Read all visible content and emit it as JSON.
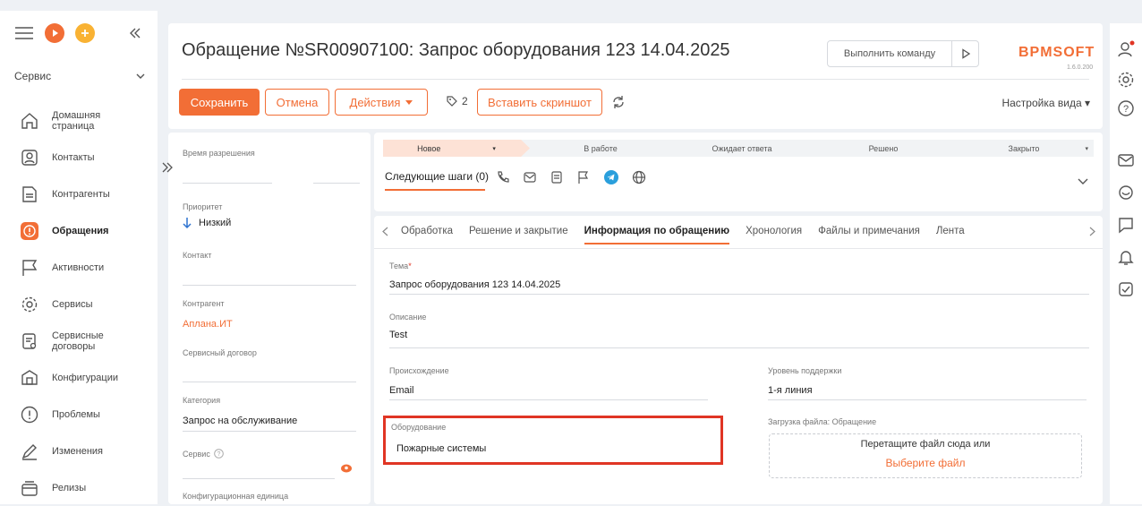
{
  "nav": {
    "section": "Сервис",
    "items": [
      {
        "label": "Домашняя страница",
        "icon": "home-icon"
      },
      {
        "label": "Контакты",
        "icon": "contact-icon"
      },
      {
        "label": "Контрагенты",
        "icon": "account-icon"
      },
      {
        "label": "Обращения",
        "icon": "case-icon",
        "active": true
      },
      {
        "label": "Активности",
        "icon": "flag-icon"
      },
      {
        "label": "Сервисы",
        "icon": "gear-icon"
      },
      {
        "label": "Сервисные договоры",
        "icon": "contract-icon"
      },
      {
        "label": "Конфигурации",
        "icon": "config-icon"
      },
      {
        "label": "Проблемы",
        "icon": "problem-icon"
      },
      {
        "label": "Изменения",
        "icon": "pencil-icon"
      },
      {
        "label": "Релизы",
        "icon": "release-icon"
      }
    ]
  },
  "header": {
    "title": "Обращение №SR00907100: Запрос оборудования 123 14.04.2025",
    "command_placeholder": "Выполнить команду",
    "logo": "BPMSOFT",
    "version": "1.6.0.200",
    "save": "Сохранить",
    "cancel": "Отмена",
    "actions": "Действия",
    "counter": "2",
    "screenshot": "Вставить скриншот",
    "view_settings": "Настройка вида"
  },
  "left": {
    "resolution_time_label": "Время разрешения",
    "priority_label": "Приоритет",
    "priority_value": "Низкий",
    "contact_label": "Контакт",
    "account_label": "Контрагент",
    "account_value": "Аплана.ИТ",
    "contract_label": "Сервисный договор",
    "category_label": "Категория",
    "category_value": "Запрос на обслуживание",
    "service_label": "Сервис",
    "config_item_label": "Конфигурационная единица"
  },
  "stages": [
    "Новое",
    "В работе",
    "Ожидает ответа",
    "Решено",
    "Закрыто"
  ],
  "next_steps": "Следующие шаги (0)",
  "tabs": [
    "Обработка",
    "Решение и закрытие",
    "Информация по обращению",
    "Хронология",
    "Файлы и примечания",
    "Лента"
  ],
  "form": {
    "subject_label": "Тема",
    "subject_value": "Запрос оборудования 123 14.04.2025",
    "description_label": "Описание",
    "description_value": "Test",
    "origin_label": "Происхождение",
    "origin_value": "Email",
    "support_level_label": "Уровень поддержки",
    "support_level_value": "1-я линия",
    "equipment_label": "Оборудование",
    "equipment_value": "Пожарные системы",
    "upload_label": "Загрузка файла: Обращение",
    "drop_text": "Перетащите файл сюда или",
    "choose_file": "Выберите файл"
  },
  "colors": {
    "accent": "#f26e36",
    "highlight": "#e03524",
    "telegram": "#2a9fdc"
  }
}
